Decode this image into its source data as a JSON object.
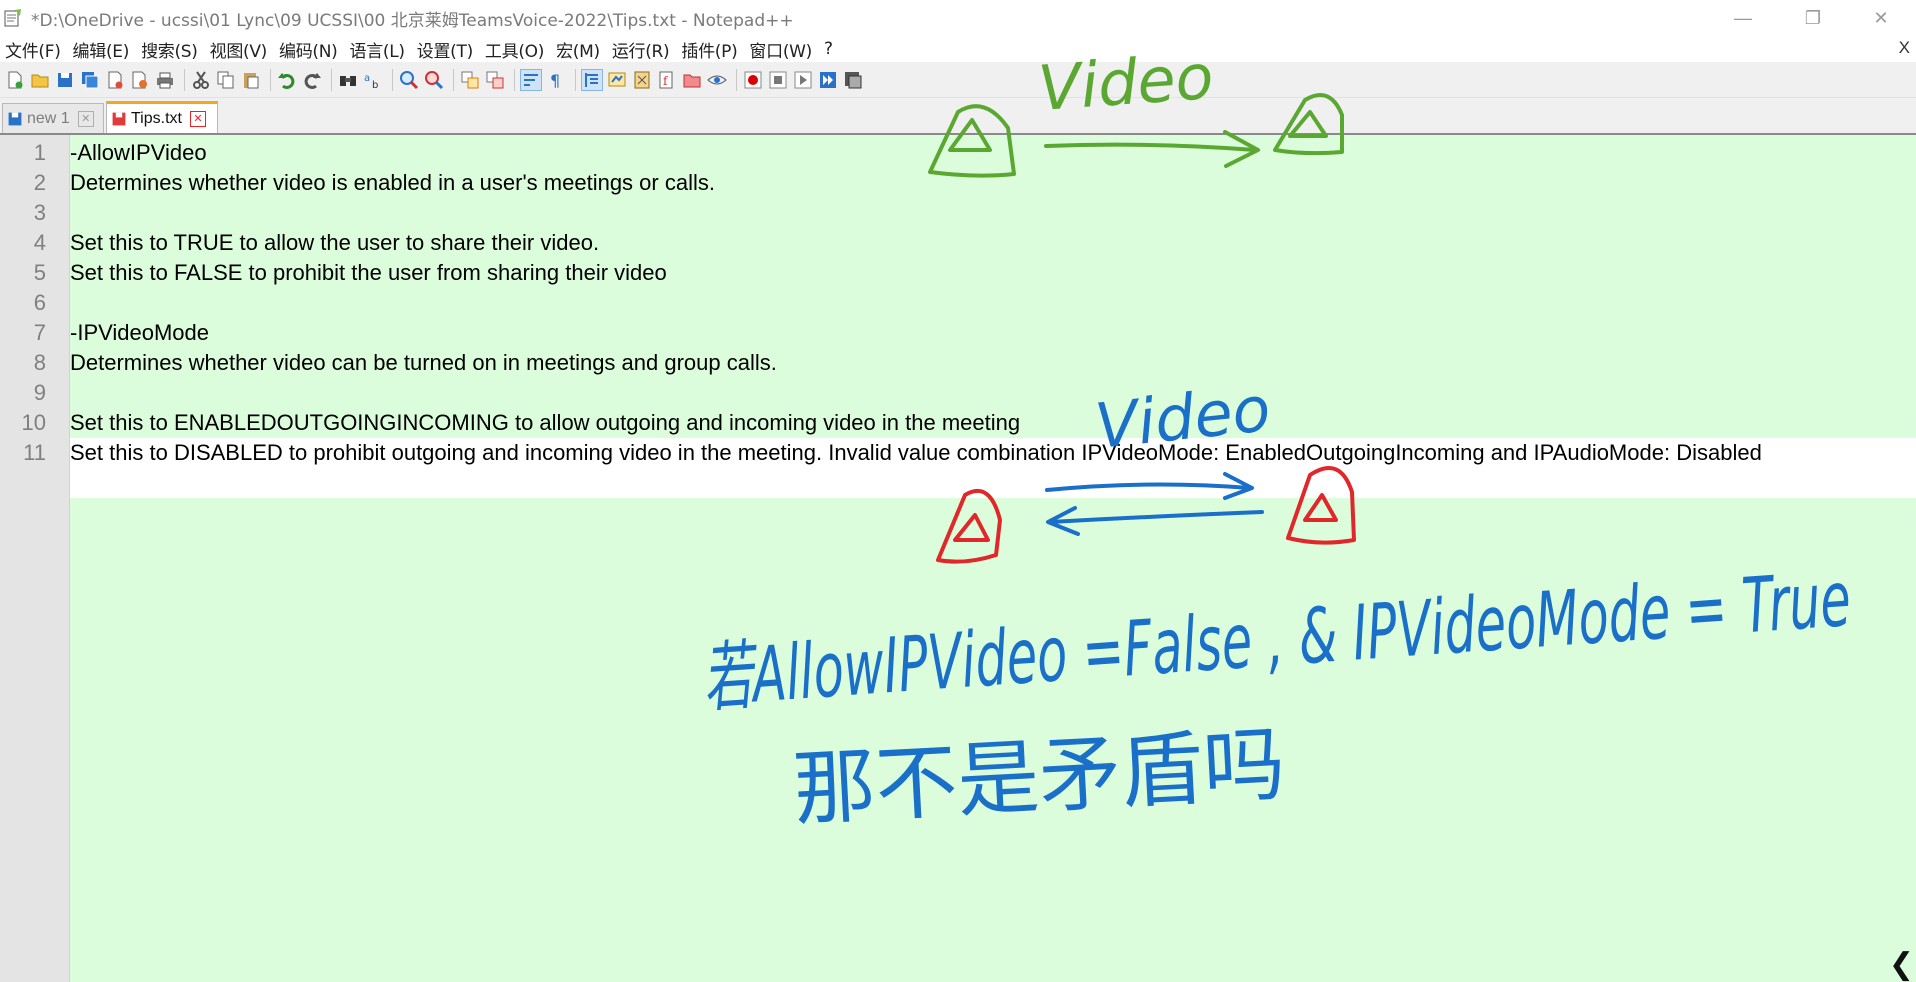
{
  "window": {
    "title": "*D:\\OneDrive - ucssi\\01 Lync\\09 UCSSI\\00 北京莱姆TeamsVoice-2022\\Tips.txt - Notepad++",
    "minimize_glyph": "—",
    "maximize_glyph": "❐",
    "close_glyph": "✕"
  },
  "menu": {
    "items": [
      "文件(F)",
      "编辑(E)",
      "搜索(S)",
      "视图(V)",
      "编码(N)",
      "语言(L)",
      "设置(T)",
      "工具(O)",
      "宏(M)",
      "运行(R)",
      "插件(P)",
      "窗口(W)",
      "?"
    ],
    "close_doc": "X"
  },
  "tabs": [
    {
      "label": "new 1",
      "active": false
    },
    {
      "label": "Tips.txt",
      "active": true
    }
  ],
  "editor": {
    "line_numbers": [
      "1",
      "2",
      "3",
      "4",
      "5",
      "6",
      "7",
      "8",
      "9",
      "10",
      "11"
    ],
    "lines": [
      "-AllowIPVideo",
      "Determines whether video is enabled in a user's meetings or calls.",
      "",
      "Set this to TRUE to allow the user to share their video.",
      "Set this to FALSE to prohibit the user from sharing their video",
      "",
      "-IPVideoMode",
      "Determines whether video can be turned on in meetings and group calls.",
      "",
      "Set this to ENABLEDOUTGOINGINCOMING to allow outgoing and incoming video in the meeting",
      "Set this to DISABLED to prohibit outgoing and incoming video in the meeting. Invalid value combination IPVideoMode: EnabledOutgoingIncoming and IPAudioMode: Disabled"
    ],
    "current_line": 11,
    "colors": {
      "background": "#dcfddc",
      "current_line": "#ffffff",
      "gutter": "#e4e4e4"
    }
  },
  "annotations": {
    "green_label": "Video",
    "blue_label": "Video",
    "formula": "若AllowIPVideo =False , & IPVideoMode = True",
    "question": "那不是矛盾吗",
    "colors": {
      "green": "#5aa832",
      "blue": "#1a6fc9",
      "red": "#e0282a"
    }
  },
  "scroll_glyph": "❮"
}
